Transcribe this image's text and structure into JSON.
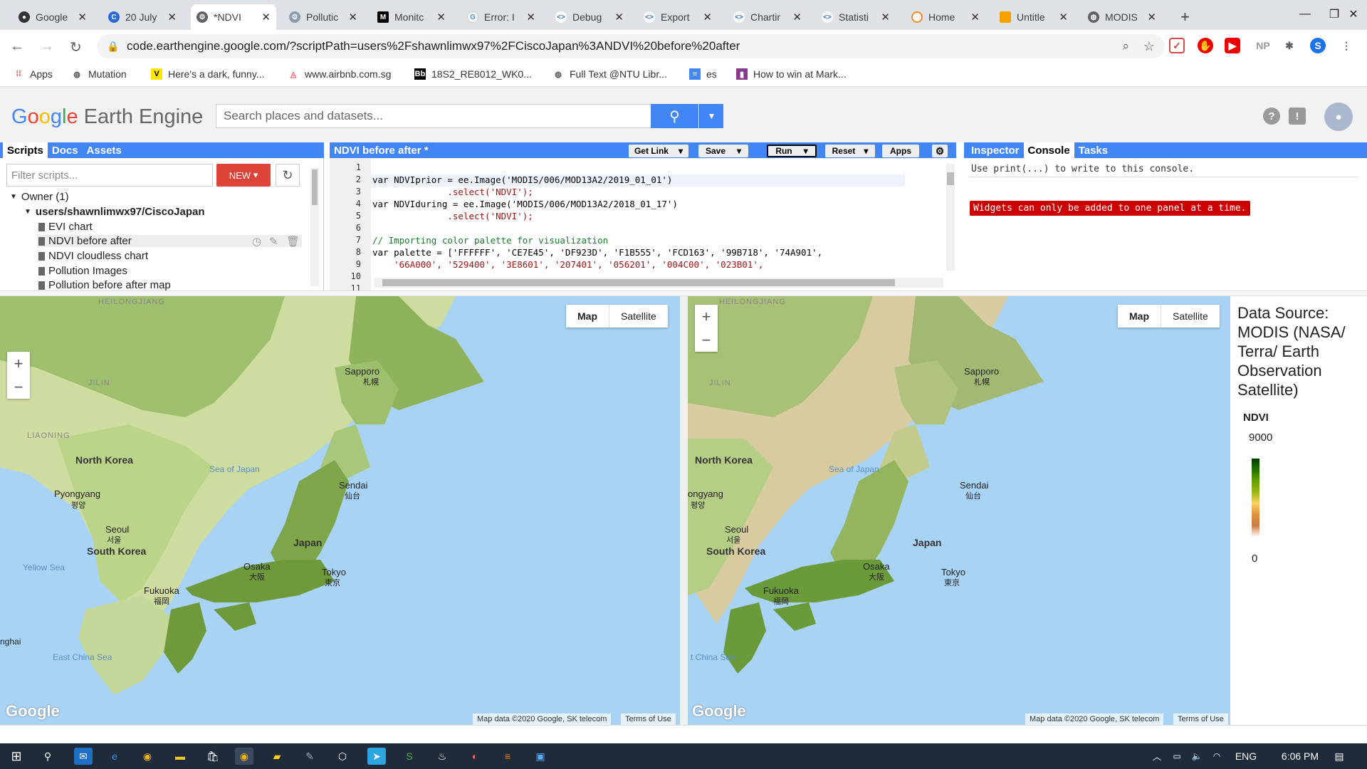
{
  "browser": {
    "tabs": [
      {
        "title": "Google",
        "icon": "github-icon"
      },
      {
        "title": "20 July",
        "icon": "c-icon"
      },
      {
        "title": "*NDVI",
        "icon": "gear-icon"
      },
      {
        "title": "Pollutic",
        "icon": "gear-icon"
      },
      {
        "title": "Monitc",
        "icon": "m-icon"
      },
      {
        "title": "Error: I",
        "icon": "google-icon"
      },
      {
        "title": "Debug",
        "icon": "code-icon"
      },
      {
        "title": "Export",
        "icon": "code-icon"
      },
      {
        "title": "Chartir",
        "icon": "code-icon"
      },
      {
        "title": "Statisti",
        "icon": "code-icon"
      },
      {
        "title": "Home",
        "icon": "loading-icon"
      },
      {
        "title": "Untitle",
        "icon": "slides-icon"
      },
      {
        "title": "MODIS",
        "icon": "globe-icon"
      }
    ],
    "new_tab": "+",
    "url": "code.earthengine.google.com/?scriptPath=users%2Fshawnlimwx97%2FCiscoJapan%3ANDVI%20before%20after",
    "profile_initial": "S",
    "ext_np": "NP",
    "bookmarks": [
      "Apps",
      "Mutation",
      "Here's a dark, funny...",
      "www.airbnb.com.sg",
      "18S2_RE8012_WK0...",
      "Full Text @NTU Libr...",
      "es",
      "How to win at Mark..."
    ]
  },
  "gee": {
    "logo_google": [
      "G",
      "o",
      "o",
      "g",
      "l",
      "e"
    ],
    "logo_rest": "Earth Engine",
    "search_placeholder": "Search places and datasets...",
    "left_tabs": [
      "Scripts",
      "Docs",
      "Assets"
    ],
    "filter_placeholder": "Filter scripts...",
    "new_label": "NEW",
    "tree": {
      "owner": "Owner (1)",
      "repo": "users/shawnlimwx97/CiscoJapan",
      "files": [
        "EVI chart",
        "NDVI before after",
        "NDVI cloudless chart",
        "Pollution Images",
        "Pollution before after map"
      ]
    },
    "editor_title": "NDVI before after *",
    "editor_buttons": [
      "Get Link",
      "Save",
      "Run",
      "Reset",
      "Apps"
    ],
    "code_lines": [
      {
        "n": "1",
        "t": ""
      },
      {
        "n": "2",
        "t": "var NDVIprior = ee.Image('MODIS/006/MOD13A2/2019_01_01')"
      },
      {
        "n": "3",
        "t": "              .select('NDVI');"
      },
      {
        "n": "4",
        "t": "var NDVIduring = ee.Image('MODIS/006/MOD13A2/2018_01_17')"
      },
      {
        "n": "5",
        "t": "              .select('NDVI');"
      },
      {
        "n": "6",
        "t": ""
      },
      {
        "n": "7",
        "t": "// Importing color palette for visualization"
      },
      {
        "n": "8",
        "t": "var palette = ['FFFFFF', 'CE7E45', 'DF923D', 'F1B555', 'FCD163', '99B718', '74A901',"
      },
      {
        "n": "9",
        "t": "    '66A000', '529400', '3E8601', '207401', '056201', '004C00', '023B01',"
      },
      {
        "n": "10",
        "t": ""
      },
      {
        "n": "11",
        "t": ""
      }
    ],
    "right_tabs": [
      "Inspector",
      "Console",
      "Tasks"
    ],
    "console_hint": "Use print(...) to write to this console.",
    "console_error": "Widgets can only be added to one panel at a time."
  },
  "maps": {
    "map_type": [
      "Map",
      "Satellite"
    ],
    "zoom_in": "+",
    "zoom_out": "−",
    "labels": {
      "heilongjiang": "HEILONGJIANG",
      "jilin": "JILIN",
      "liaoning": "LIAONING",
      "north_korea": "North Korea",
      "pyongyang": "Pyongyang",
      "pyongyang_ko": "평양",
      "pyongyang_cut": "ongyang",
      "seoul": "Seoul",
      "seoul_ko": "서울",
      "south_korea": "South Korea",
      "sea_of_japan": "Sea of Japan",
      "sapporo": "Sapporo",
      "sapporo_jp": "札幌",
      "sendai": "Sendai",
      "sendai_jp": "仙台",
      "japan": "Japan",
      "osaka": "Osaka",
      "osaka_jp": "大阪",
      "tokyo": "Tokyo",
      "tokyo_jp": "東京",
      "fukuoka": "Fukuoka",
      "fukuoka_jp": "福岡",
      "yellow_sea": "Yellow Sea",
      "east_china_sea": "East China Sea",
      "east_china_sea_cut": "t China Sea",
      "shanghai_cut": "nghai"
    },
    "google": "Google",
    "map_data": "Map data ©2020 Google, SK telecom",
    "terms": "Terms of Use"
  },
  "legend": {
    "source": [
      "Data Source:",
      "MODIS (NASA/",
      "Terra/ Earth",
      "Observation",
      "Satellite)"
    ],
    "title": "NDVI",
    "max": "9000",
    "min": "0"
  },
  "taskbar": {
    "lang": "ENG",
    "time": "6:06 PM"
  }
}
